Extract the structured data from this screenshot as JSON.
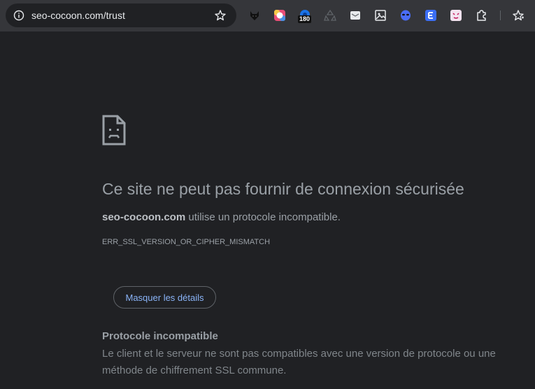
{
  "browser": {
    "address_bar": {
      "url": "seo-cocoon.com/trust",
      "site_info_icon": "info-icon",
      "bookmark_icon": "star-icon"
    },
    "extensions": [
      {
        "name": "wolf-extension-icon"
      },
      {
        "name": "color-ring-extension-icon"
      },
      {
        "name": "counter-extension-icon",
        "badge": "180"
      },
      {
        "name": "recycle-extension-icon"
      },
      {
        "name": "mail-extension-icon"
      },
      {
        "name": "image-extension-icon"
      },
      {
        "name": "alien-extension-icon"
      },
      {
        "name": "e-extension-icon"
      },
      {
        "name": "pink-face-extension-icon"
      },
      {
        "name": "puzzle-icon"
      },
      {
        "name": "bookmarks-star-icon"
      }
    ]
  },
  "error_page": {
    "icon": "sad-document-icon",
    "title": "Ce site ne peut pas fournir de connexion sécurisée",
    "host": "seo-cocoon.com",
    "message_rest": " utilise un protocole incompatible.",
    "error_code": "ERR_SSL_VERSION_OR_CIPHER_MISMATCH",
    "details_button_label": "Masquer les détails",
    "details_title": "Protocole incompatible",
    "details_text": "Le client et le serveur ne sont pas compatibles avec une version de protocole ou une méthode de chiffrement SSL commune."
  },
  "colors": {
    "toolbar_bg": "#35363a",
    "page_bg": "#202124",
    "text": "#9aa0a6",
    "link_accent": "#8ab4f8"
  }
}
